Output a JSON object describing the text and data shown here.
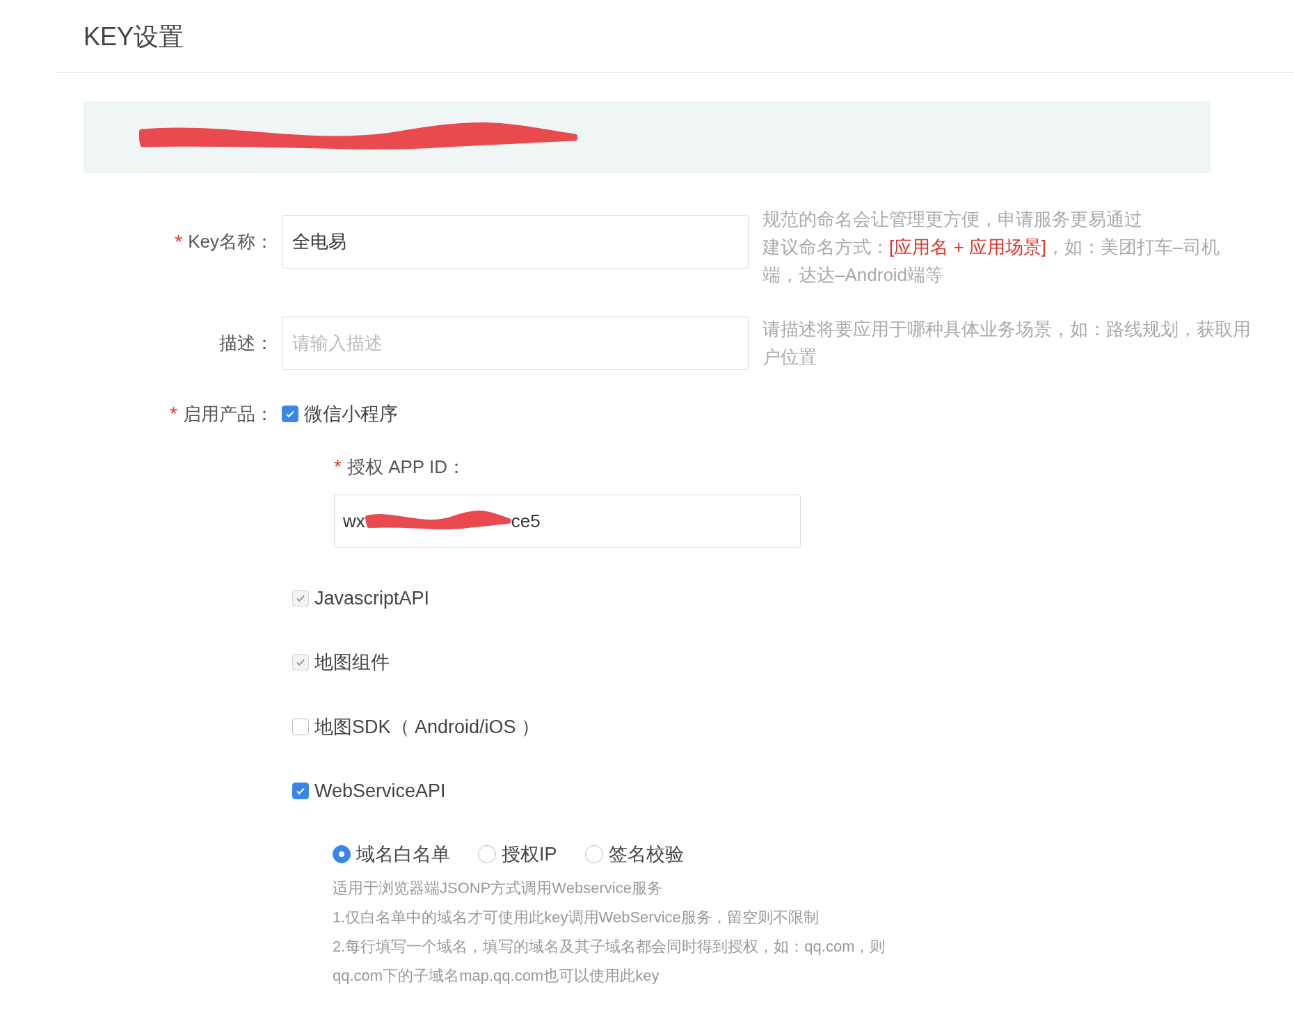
{
  "page_title": "KEY设置",
  "form": {
    "name_field": {
      "label": "Key名称：",
      "required_mark": "*",
      "value": "全电易",
      "hint_lines": [
        "规范的命名会让管理更方便，申请服务更易通过",
        "建议命名方式：**[应用名 + 应用场景]**，如：美团打车–司机端，达达–Android端等"
      ]
    },
    "description_field": {
      "label": "描述：",
      "placeholder": "请输入描述",
      "hint": "请描述将要应用于哪种具体业务场景，如：路线规划，获取用户位置"
    },
    "products_label": {
      "label": "启用产品：",
      "required_mark": "*"
    },
    "products": [
      {
        "kind": "appid",
        "label": "微信小程序",
        "checked": true,
        "disabled": false,
        "sub_label": "授权 APP ID：",
        "sub_required_mark": "*",
        "value_start": "wx",
        "value_end": "ce5"
      },
      {
        "kind": "plain",
        "label": "JavascriptAPI",
        "checked": true,
        "disabled": true
      },
      {
        "kind": "plain",
        "label": "地图组件",
        "checked": true,
        "disabled": true
      },
      {
        "kind": "plain",
        "label": "地图SDK（ Android/iOS ）",
        "checked": false,
        "disabled": false
      },
      {
        "kind": "modes",
        "label": "WebServiceAPI",
        "checked": true,
        "disabled": false,
        "options": [
          {
            "label": "域名白名单",
            "selected": true
          },
          {
            "label": "授权IP",
            "selected": false
          },
          {
            "label": "签名校验",
            "selected": false
          }
        ],
        "help_lines": [
          "适用于浏览器端JSONP方式调用Webservice服务",
          "1.仅白名单中的域名才可使用此key调用WebService服务，留空则不限制",
          "2.每行填写一个域名，填写的域名及其子域名都会同时得到授权，如：qq.com，则",
          "qq.com下的子域名map.qq.com也可以使用此key"
        ]
      }
    ]
  }
}
